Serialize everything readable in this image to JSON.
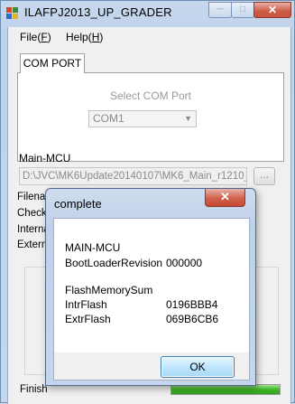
{
  "window": {
    "title": "ILAFPJ2013_UP_GRADER"
  },
  "menu": {
    "file_main": "File(",
    "file_key": "F",
    "file_end": ")",
    "help_main": "Help(",
    "help_key": "H",
    "help_end": ")"
  },
  "com": {
    "tab_label": "COM PORT",
    "select_label": "Select COM Port",
    "selected_value": "COM1"
  },
  "main_mcu": {
    "label": "Main-MCU",
    "path": "D:\\JVC\\MK6Update20140107\\MK6_Main_r1210_",
    "browse_label": "..."
  },
  "info_labels": [
    "Filenam",
    "CheckS",
    "Interna",
    "Externa"
  ],
  "status": {
    "text": "Finish",
    "progress": 1.0,
    "color": "#3fb526"
  },
  "dialog": {
    "title": "complete",
    "close_label": "✕",
    "heading": "MAIN-MCU",
    "bootloader_label": "BootLoaderRevision",
    "bootloader_value": "000000",
    "sum_label": "FlashMemorySum",
    "intr_label": "IntrFlash",
    "intr_value": "0196BBB4",
    "extr_label": "ExtrFlash",
    "extr_value": "069B6CB6",
    "ok_label": "OK"
  },
  "colors": {
    "close_red": "#c8553f",
    "ok_blue": "#3c7fb1"
  }
}
